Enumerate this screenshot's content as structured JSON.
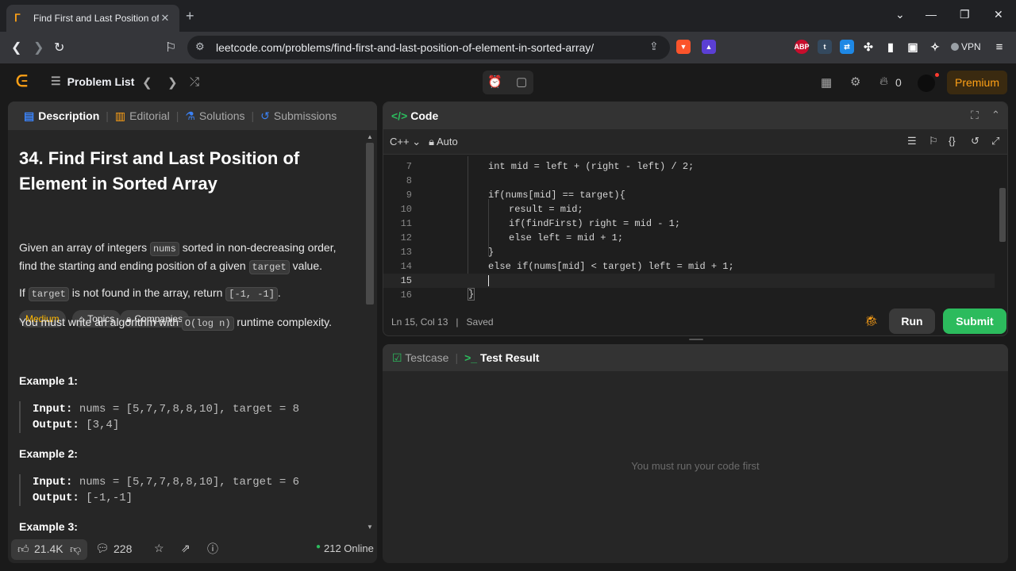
{
  "browser": {
    "tab_title": "Find First and Last Position of E",
    "url": "leetcode.com/problems/find-first-and-last-position-of-element-in-sorted-array/",
    "vpn_label": "VPN",
    "ext_abp": "ABP",
    "ext_t": "t"
  },
  "header": {
    "problem_list": "Problem List",
    "streak_count": "0",
    "premium_label": "Premium"
  },
  "left": {
    "tabs": [
      "Description",
      "Editorial",
      "Solutions",
      "Submissions"
    ],
    "title": "34. Find First and Last Position of Element in Sorted Array",
    "difficulty": "Medium",
    "chip_topics": "Topics",
    "chip_companies": "Companies",
    "p1_a": "Given an array of integers",
    "p1_code1": "nums",
    "p1_b": "sorted in non-decreasing order, find the starting and ending position of a given",
    "p1_code2": "target",
    "p1_c": "value.",
    "p2_a": "If",
    "p2_code1": "target",
    "p2_b": "is not found in the array, return",
    "p2_code2": "[-1, -1]",
    "p2_c": ".",
    "p3_a": "You must write an algorithm with",
    "p3_code": "O(log n)",
    "p3_b": "runtime complexity.",
    "examples": [
      {
        "heading": "Example 1:",
        "input_label": "Input:",
        "input": "nums = [5,7,7,8,8,10], target = 8",
        "output_label": "Output:",
        "output": "[3,4]"
      },
      {
        "heading": "Example 2:",
        "input_label": "Input:",
        "input": "nums = [5,7,7,8,8,10], target = 6",
        "output_label": "Output:",
        "output": "[-1,-1]"
      },
      {
        "heading": "Example 3:"
      }
    ],
    "likes": "21.4K",
    "comments": "228",
    "online": "212 Online"
  },
  "code": {
    "title": "Code",
    "language": "C++",
    "mode": "Auto",
    "lines": [
      {
        "n": "7",
        "text": "int mid = left + (right - left) / 2;"
      },
      {
        "n": "8",
        "text": ""
      },
      {
        "n": "9",
        "text": "if(nums[mid] == target){"
      },
      {
        "n": "10",
        "text": "result = mid;"
      },
      {
        "n": "11",
        "text": "if(findFirst) right = mid - 1;"
      },
      {
        "n": "12",
        "text": "else left = mid + 1;"
      },
      {
        "n": "13",
        "text": "}"
      },
      {
        "n": "14",
        "text": "else if(nums[mid] < target) left = mid + 1;"
      },
      {
        "n": "15",
        "text": ""
      },
      {
        "n": "16",
        "text": "}"
      }
    ],
    "cursor_pos": "Ln 15, Col 13",
    "save_state": "Saved",
    "run_label": "Run",
    "submit_label": "Submit"
  },
  "result": {
    "tab_testcase": "Testcase",
    "tab_result": "Test Result",
    "message": "You must run your code first"
  },
  "colors": {
    "accent": "#ffa116",
    "submit": "#2cbb5d",
    "difficulty_medium": "#ffb800"
  }
}
